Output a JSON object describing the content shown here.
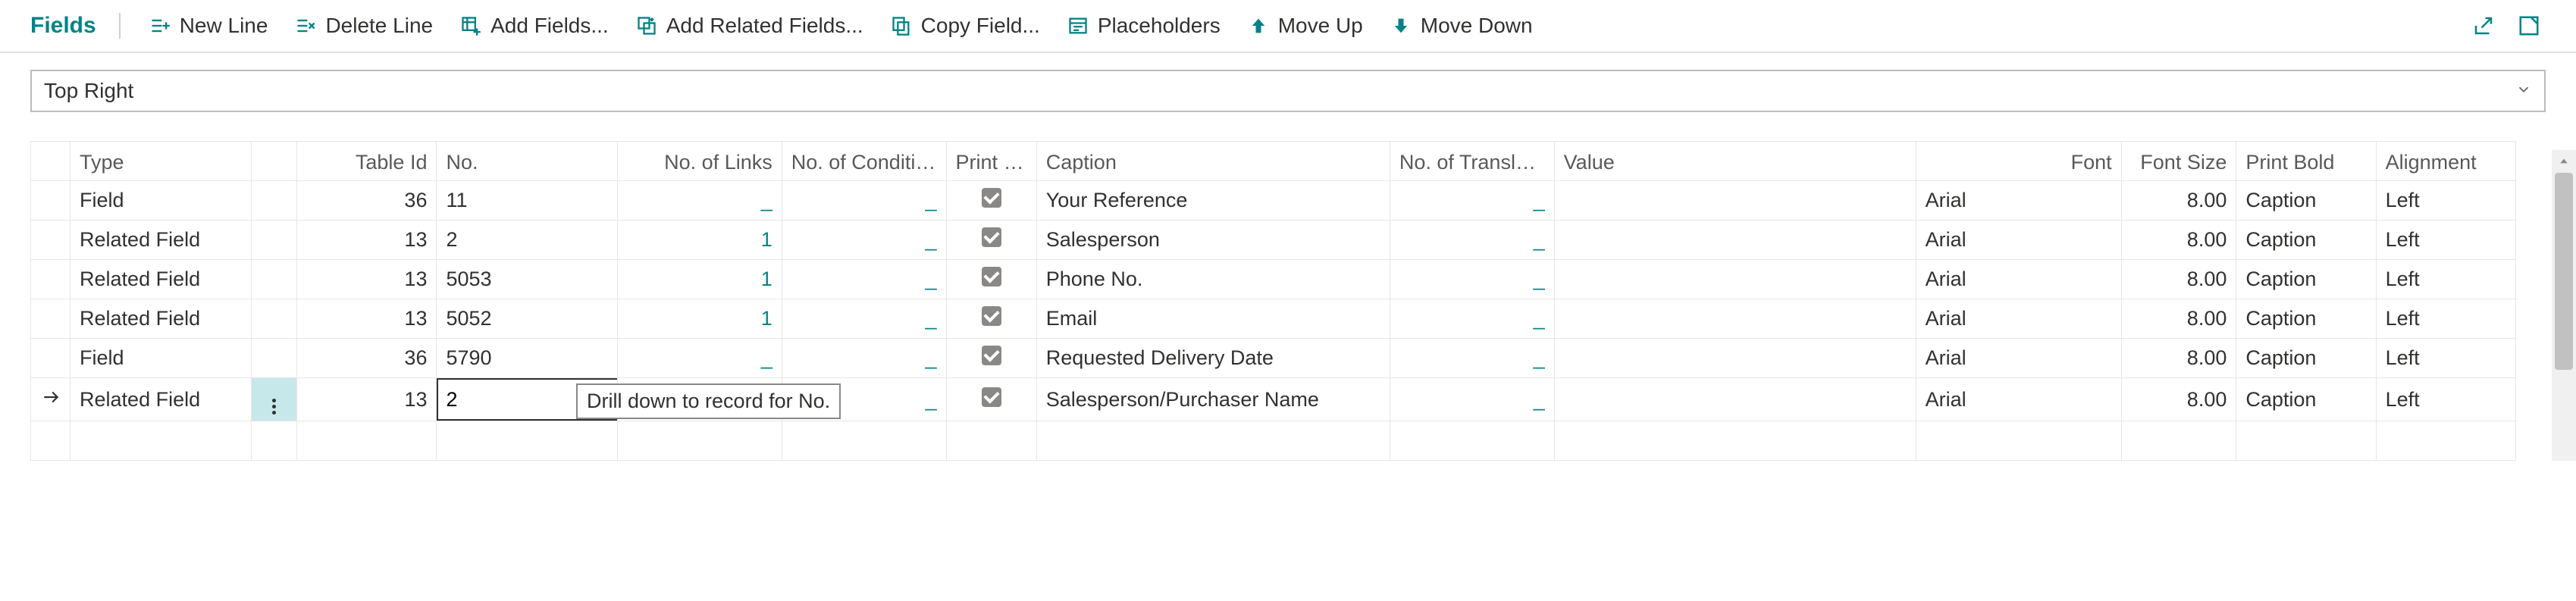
{
  "toolbar": {
    "title": "Fields",
    "new_line": "New Line",
    "delete_line": "Delete Line",
    "add_fields": "Add Fields...",
    "add_related_fields": "Add Related Fields...",
    "copy_field": "Copy Field...",
    "placeholders": "Placeholders",
    "move_up": "Move Up",
    "move_down": "Move Down"
  },
  "dropdown": {
    "value": "Top Right"
  },
  "columns": {
    "type": "Type",
    "table_id": "Table Id",
    "no": "No.",
    "no_links": "No. of Links",
    "no_conditions": "No. of Conditions",
    "print_capt": "Print Capt...",
    "caption": "Caption",
    "no_translations": "No. of Translations",
    "value": "Value",
    "font": "Font",
    "font_size": "Font Size",
    "print_bold": "Print Bold",
    "alignment": "Alignment"
  },
  "rows": [
    {
      "type": "Field",
      "table_id": "36",
      "no": "11",
      "links": "_",
      "conds": "_",
      "capt": true,
      "caption": "Your Reference",
      "trans": "_",
      "value": "",
      "font": "Arial",
      "fsize": "8.00",
      "bold": "Caption",
      "align": "Left"
    },
    {
      "type": "Related Field",
      "table_id": "13",
      "no": "2",
      "links": "1",
      "conds": "_",
      "capt": true,
      "caption": "Salesperson",
      "trans": "_",
      "value": "",
      "font": "Arial",
      "fsize": "8.00",
      "bold": "Caption",
      "align": "Left"
    },
    {
      "type": "Related Field",
      "table_id": "13",
      "no": "5053",
      "links": "1",
      "conds": "_",
      "capt": true,
      "caption": "Phone No.",
      "trans": "_",
      "value": "",
      "font": "Arial",
      "fsize": "8.00",
      "bold": "Caption",
      "align": "Left"
    },
    {
      "type": "Related Field",
      "table_id": "13",
      "no": "5052",
      "links": "1",
      "conds": "_",
      "capt": true,
      "caption": "Email",
      "trans": "_",
      "value": "",
      "font": "Arial",
      "fsize": "8.00",
      "bold": "Caption",
      "align": "Left"
    },
    {
      "type": "Field",
      "table_id": "36",
      "no": "5790",
      "links": "_",
      "conds": "_",
      "capt": true,
      "caption": "Requested Delivery Date",
      "trans": "_",
      "value": "",
      "font": "Arial",
      "fsize": "8.00",
      "bold": "Caption",
      "align": "Left"
    },
    {
      "type": "Related Field",
      "table_id": "13",
      "no": "2",
      "links": "1",
      "conds": "_",
      "capt": true,
      "caption": "Salesperson/Purchaser Name",
      "trans": "_",
      "value": "",
      "font": "Arial",
      "fsize": "8.00",
      "bold": "Caption",
      "align": "Left",
      "active": true
    }
  ],
  "tooltip": "Drill down to record for No."
}
